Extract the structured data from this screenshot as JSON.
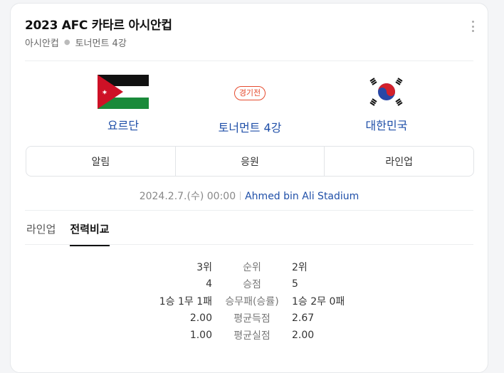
{
  "header": {
    "title": "2023 AFC 카타르 아시안컵",
    "subtitle_items": [
      "아시안컵",
      "토너먼트 4강"
    ]
  },
  "match": {
    "home": {
      "name": "요르단",
      "flag": "jordan-flag"
    },
    "away": {
      "name": "대한민국",
      "flag": "korea-flag"
    },
    "badge": "경기전",
    "round": "토너먼트 4강",
    "datetime": "2024.2.7.(수) 00:00",
    "venue": "Ahmed bin Ali Stadium"
  },
  "tabs": [
    "알림",
    "응원",
    "라인업"
  ],
  "subtabs": {
    "items": [
      "라인업",
      "전력비교"
    ],
    "active": "전력비교"
  },
  "stats": [
    {
      "home": "3위",
      "label": "순위",
      "away": "2위"
    },
    {
      "home": "4",
      "label": "승점",
      "away": "5"
    },
    {
      "home": "1승 1무 1패",
      "label": "승무패(승률)",
      "away": "1승 2무 0패"
    },
    {
      "home": "2.00",
      "label": "평균득점",
      "away": "2.67"
    },
    {
      "home": "1.00",
      "label": "평균실점",
      "away": "2.00"
    }
  ],
  "colors": {
    "link": "#1f4fa8",
    "badge": "#e54b2e"
  }
}
